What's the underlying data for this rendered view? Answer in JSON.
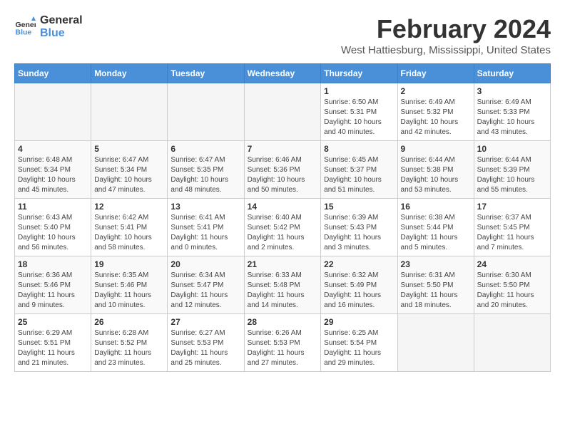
{
  "logo": {
    "line1": "General",
    "line2": "Blue"
  },
  "title": "February 2024",
  "subtitle": "West Hattiesburg, Mississippi, United States",
  "days_of_week": [
    "Sunday",
    "Monday",
    "Tuesday",
    "Wednesday",
    "Thursday",
    "Friday",
    "Saturday"
  ],
  "weeks": [
    [
      {
        "num": "",
        "detail": ""
      },
      {
        "num": "",
        "detail": ""
      },
      {
        "num": "",
        "detail": ""
      },
      {
        "num": "",
        "detail": ""
      },
      {
        "num": "1",
        "detail": "Sunrise: 6:50 AM\nSunset: 5:31 PM\nDaylight: 10 hours\nand 40 minutes."
      },
      {
        "num": "2",
        "detail": "Sunrise: 6:49 AM\nSunset: 5:32 PM\nDaylight: 10 hours\nand 42 minutes."
      },
      {
        "num": "3",
        "detail": "Sunrise: 6:49 AM\nSunset: 5:33 PM\nDaylight: 10 hours\nand 43 minutes."
      }
    ],
    [
      {
        "num": "4",
        "detail": "Sunrise: 6:48 AM\nSunset: 5:34 PM\nDaylight: 10 hours\nand 45 minutes."
      },
      {
        "num": "5",
        "detail": "Sunrise: 6:47 AM\nSunset: 5:34 PM\nDaylight: 10 hours\nand 47 minutes."
      },
      {
        "num": "6",
        "detail": "Sunrise: 6:47 AM\nSunset: 5:35 PM\nDaylight: 10 hours\nand 48 minutes."
      },
      {
        "num": "7",
        "detail": "Sunrise: 6:46 AM\nSunset: 5:36 PM\nDaylight: 10 hours\nand 50 minutes."
      },
      {
        "num": "8",
        "detail": "Sunrise: 6:45 AM\nSunset: 5:37 PM\nDaylight: 10 hours\nand 51 minutes."
      },
      {
        "num": "9",
        "detail": "Sunrise: 6:44 AM\nSunset: 5:38 PM\nDaylight: 10 hours\nand 53 minutes."
      },
      {
        "num": "10",
        "detail": "Sunrise: 6:44 AM\nSunset: 5:39 PM\nDaylight: 10 hours\nand 55 minutes."
      }
    ],
    [
      {
        "num": "11",
        "detail": "Sunrise: 6:43 AM\nSunset: 5:40 PM\nDaylight: 10 hours\nand 56 minutes."
      },
      {
        "num": "12",
        "detail": "Sunrise: 6:42 AM\nSunset: 5:41 PM\nDaylight: 10 hours\nand 58 minutes."
      },
      {
        "num": "13",
        "detail": "Sunrise: 6:41 AM\nSunset: 5:41 PM\nDaylight: 11 hours\nand 0 minutes."
      },
      {
        "num": "14",
        "detail": "Sunrise: 6:40 AM\nSunset: 5:42 PM\nDaylight: 11 hours\nand 2 minutes."
      },
      {
        "num": "15",
        "detail": "Sunrise: 6:39 AM\nSunset: 5:43 PM\nDaylight: 11 hours\nand 3 minutes."
      },
      {
        "num": "16",
        "detail": "Sunrise: 6:38 AM\nSunset: 5:44 PM\nDaylight: 11 hours\nand 5 minutes."
      },
      {
        "num": "17",
        "detail": "Sunrise: 6:37 AM\nSunset: 5:45 PM\nDaylight: 11 hours\nand 7 minutes."
      }
    ],
    [
      {
        "num": "18",
        "detail": "Sunrise: 6:36 AM\nSunset: 5:46 PM\nDaylight: 11 hours\nand 9 minutes."
      },
      {
        "num": "19",
        "detail": "Sunrise: 6:35 AM\nSunset: 5:46 PM\nDaylight: 11 hours\nand 10 minutes."
      },
      {
        "num": "20",
        "detail": "Sunrise: 6:34 AM\nSunset: 5:47 PM\nDaylight: 11 hours\nand 12 minutes."
      },
      {
        "num": "21",
        "detail": "Sunrise: 6:33 AM\nSunset: 5:48 PM\nDaylight: 11 hours\nand 14 minutes."
      },
      {
        "num": "22",
        "detail": "Sunrise: 6:32 AM\nSunset: 5:49 PM\nDaylight: 11 hours\nand 16 minutes."
      },
      {
        "num": "23",
        "detail": "Sunrise: 6:31 AM\nSunset: 5:50 PM\nDaylight: 11 hours\nand 18 minutes."
      },
      {
        "num": "24",
        "detail": "Sunrise: 6:30 AM\nSunset: 5:50 PM\nDaylight: 11 hours\nand 20 minutes."
      }
    ],
    [
      {
        "num": "25",
        "detail": "Sunrise: 6:29 AM\nSunset: 5:51 PM\nDaylight: 11 hours\nand 21 minutes."
      },
      {
        "num": "26",
        "detail": "Sunrise: 6:28 AM\nSunset: 5:52 PM\nDaylight: 11 hours\nand 23 minutes."
      },
      {
        "num": "27",
        "detail": "Sunrise: 6:27 AM\nSunset: 5:53 PM\nDaylight: 11 hours\nand 25 minutes."
      },
      {
        "num": "28",
        "detail": "Sunrise: 6:26 AM\nSunset: 5:53 PM\nDaylight: 11 hours\nand 27 minutes."
      },
      {
        "num": "29",
        "detail": "Sunrise: 6:25 AM\nSunset: 5:54 PM\nDaylight: 11 hours\nand 29 minutes."
      },
      {
        "num": "",
        "detail": ""
      },
      {
        "num": "",
        "detail": ""
      }
    ]
  ]
}
